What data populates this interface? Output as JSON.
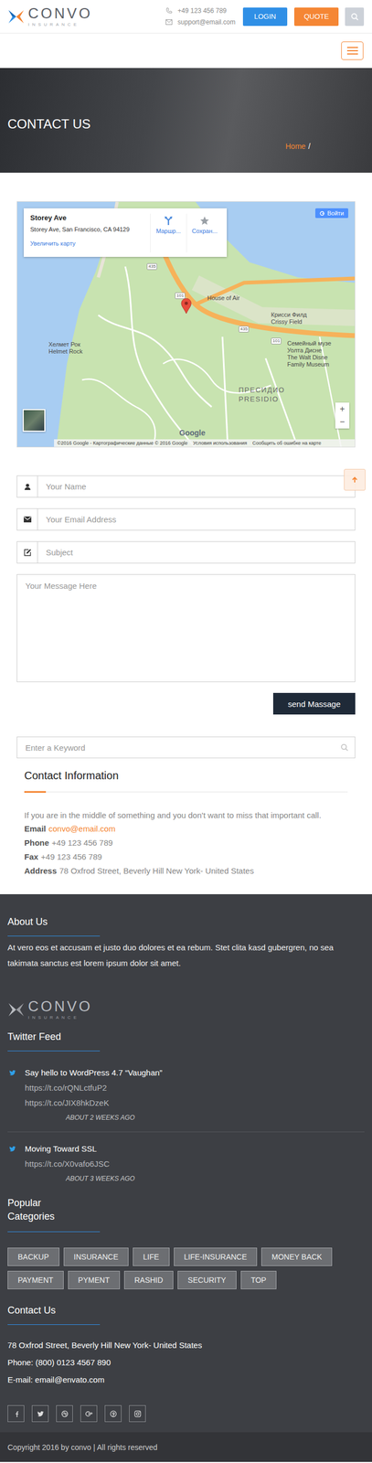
{
  "header": {
    "logo": {
      "name": "CONVO",
      "tagline": "INSURANCE"
    },
    "phone": "+49 123 456 789",
    "email": "support@email.com",
    "buttons": [
      "LOGIN",
      "QUOTE"
    ]
  },
  "hero": {
    "title": "CONTACT US",
    "breadcrumb": [
      "Home"
    ],
    "separator": "/"
  },
  "map": {
    "place": {
      "title": "Storey Ave",
      "address": "Storey Ave, San Francisco, CA 94129",
      "link": "Увеличить карту",
      "actions": [
        "Маршр...",
        "Сохран..."
      ]
    },
    "sign_in": "Войти",
    "zoom": [
      "+",
      "−"
    ],
    "labels": [
      {
        "lines": [
          "House of Air"
        ],
        "kind": "poi"
      },
      {
        "lines": [
          "Крисси Филд",
          "Crissy Field"
        ],
        "kind": "poi"
      },
      {
        "lines": [
          "Хелмет Рок",
          "Helmet Rock"
        ],
        "kind": "poi"
      },
      {
        "lines": [
          "Семейный музе",
          "Уолта Дисне",
          "The Walt Disne",
          "Family Museum"
        ],
        "kind": "poi"
      },
      {
        "lines": [
          "ПРЕСИДИО",
          "PRESIDIO"
        ],
        "kind": "district"
      }
    ],
    "shields": [
      "435",
      "101",
      "435",
      "101"
    ],
    "brand": "Google",
    "footer": [
      "©2016 Google - Картографические данные © 2016 Google",
      "Условия использования",
      "Сообщить об ошибке на карте"
    ]
  },
  "form": {
    "fields": [
      {
        "placeholder": "Your Name",
        "kind": "name"
      },
      {
        "placeholder": "Your Email Address",
        "kind": "email"
      },
      {
        "placeholder": "Subject",
        "kind": "subject"
      },
      {
        "placeholder": "Your Message Here",
        "kind": "message"
      }
    ],
    "submit": "send Massage"
  },
  "search": {
    "placeholder": "Enter a Keyword"
  },
  "contact_info": {
    "title": "Contact Information",
    "intro": "If you are in the middle of something and you don't want to miss that important call.",
    "items": [
      {
        "label": "Email",
        "value": "convo@email.com",
        "kind": "link"
      },
      {
        "label": "Phone",
        "value": "+49 123 456 789",
        "kind": "text"
      },
      {
        "label": "Fax",
        "value": "+49 123 456 789",
        "kind": "text"
      },
      {
        "label": "Address",
        "value": "78 Oxfrod Street, Beverly Hill New York- United States",
        "kind": "text"
      }
    ]
  },
  "footer": {
    "about": {
      "title": "About Us",
      "text": "At vero eos et accusam et justo duo dolores et ea rebum. Stet clita kasd gubergren, no sea takimata sanctus est lorem ipsum dolor sit amet."
    },
    "logo": {
      "name": "CONVO",
      "tagline": "INSURANCE"
    },
    "twitter": {
      "title": "Twitter Feed",
      "tweets": [
        {
          "text": "Say hello to WordPress 4.7 “Vaughan”",
          "links": [
            "https://t.co/rQNLctfuP2",
            "https://t.co/JIX8hkDzeK"
          ],
          "time": "ABOUT 2 WEEKS AGO"
        },
        {
          "text": "Moving Toward SSL",
          "links": [
            "https://t.co/X0vafo6JSC"
          ],
          "time": "ABOUT 3 WEEKS AGO"
        }
      ]
    },
    "categories": {
      "title": "Popular Categories",
      "tags": [
        "BACKUP",
        "INSURANCE",
        "LIFE",
        "LIFE-INSURANCE",
        "MONEY BACK",
        "PAYMENT",
        "PYMENT",
        "RASHID",
        "SECURITY",
        "TOP"
      ]
    },
    "contact": {
      "title": "Contact Us",
      "lines": [
        "78 Oxfrod Street, Beverly Hill New York- United States",
        "Phone: (800) 0123 4567 890",
        "E-mail: email@envato.com"
      ]
    },
    "copyright": "Copyright 2016 by convo | All rights reserved"
  }
}
